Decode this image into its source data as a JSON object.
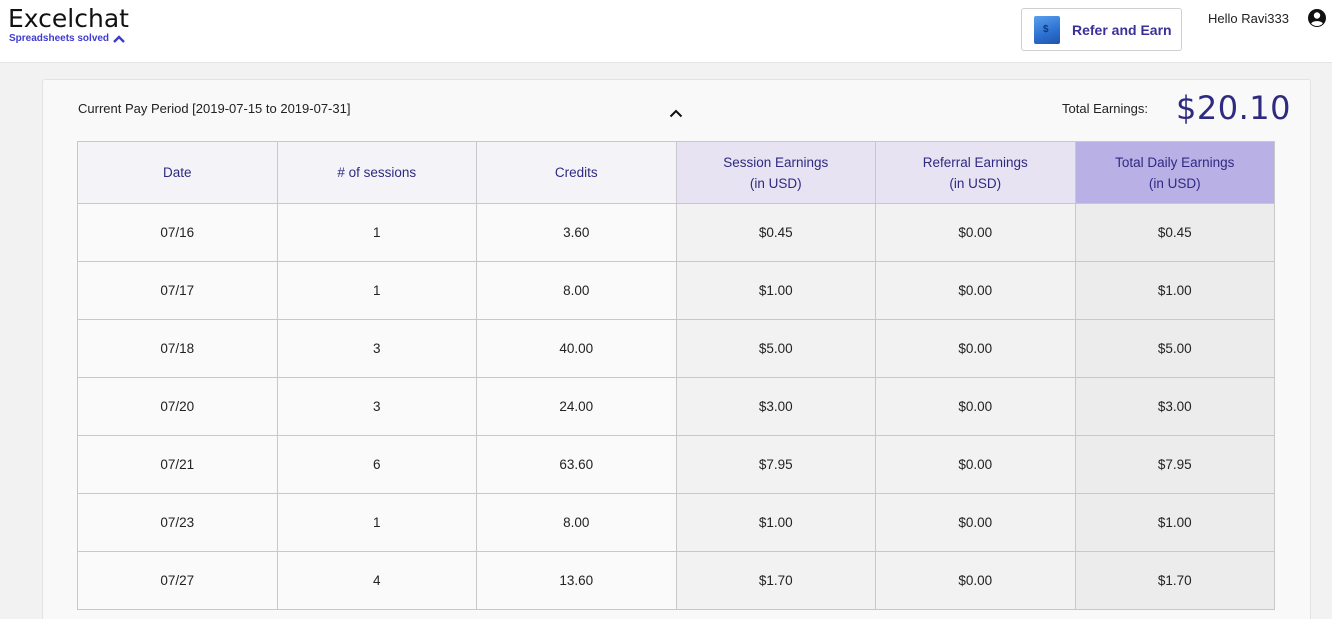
{
  "header": {
    "logo_title": "Excelchat",
    "logo_subtitle": "Spreadsheets solved",
    "refer_label": "Refer and Earn",
    "greeting": "Hello Ravi333"
  },
  "summary": {
    "period": "Current Pay Period [2019-07-15 to 2019-07-31]",
    "total_label": "Total Earnings:",
    "total_value": "$20.10"
  },
  "table": {
    "columns": [
      {
        "line1": "Date",
        "line2": ""
      },
      {
        "line1": "# of sessions",
        "line2": ""
      },
      {
        "line1": "Credits",
        "line2": ""
      },
      {
        "line1": "Session Earnings",
        "line2": "(in USD)"
      },
      {
        "line1": "Referral Earnings",
        "line2": "(in USD)"
      },
      {
        "line1": "Total Daily Earnings",
        "line2": "(in USD)"
      }
    ],
    "rows": [
      [
        "07/16",
        "1",
        "3.60",
        "$0.45",
        "$0.00",
        "$0.45"
      ],
      [
        "07/17",
        "1",
        "8.00",
        "$1.00",
        "$0.00",
        "$1.00"
      ],
      [
        "07/18",
        "3",
        "40.00",
        "$5.00",
        "$0.00",
        "$5.00"
      ],
      [
        "07/20",
        "3",
        "24.00",
        "$3.00",
        "$0.00",
        "$3.00"
      ],
      [
        "07/21",
        "6",
        "63.60",
        "$7.95",
        "$0.00",
        "$7.95"
      ],
      [
        "07/23",
        "1",
        "8.00",
        "$1.00",
        "$0.00",
        "$1.00"
      ],
      [
        "07/27",
        "4",
        "13.60",
        "$1.70",
        "$0.00",
        "$1.70"
      ]
    ]
  },
  "colors": {
    "brand": "#3f3bd0",
    "accent_text": "#2e2a80",
    "header_session": "#e7e3f3",
    "header_total": "#b9b0e6"
  },
  "icons": {
    "logo_chevron": "chevron-up-icon",
    "refer": "dollar-gift-icon",
    "user": "account-circle-icon",
    "collapse": "chevron-up-icon"
  }
}
